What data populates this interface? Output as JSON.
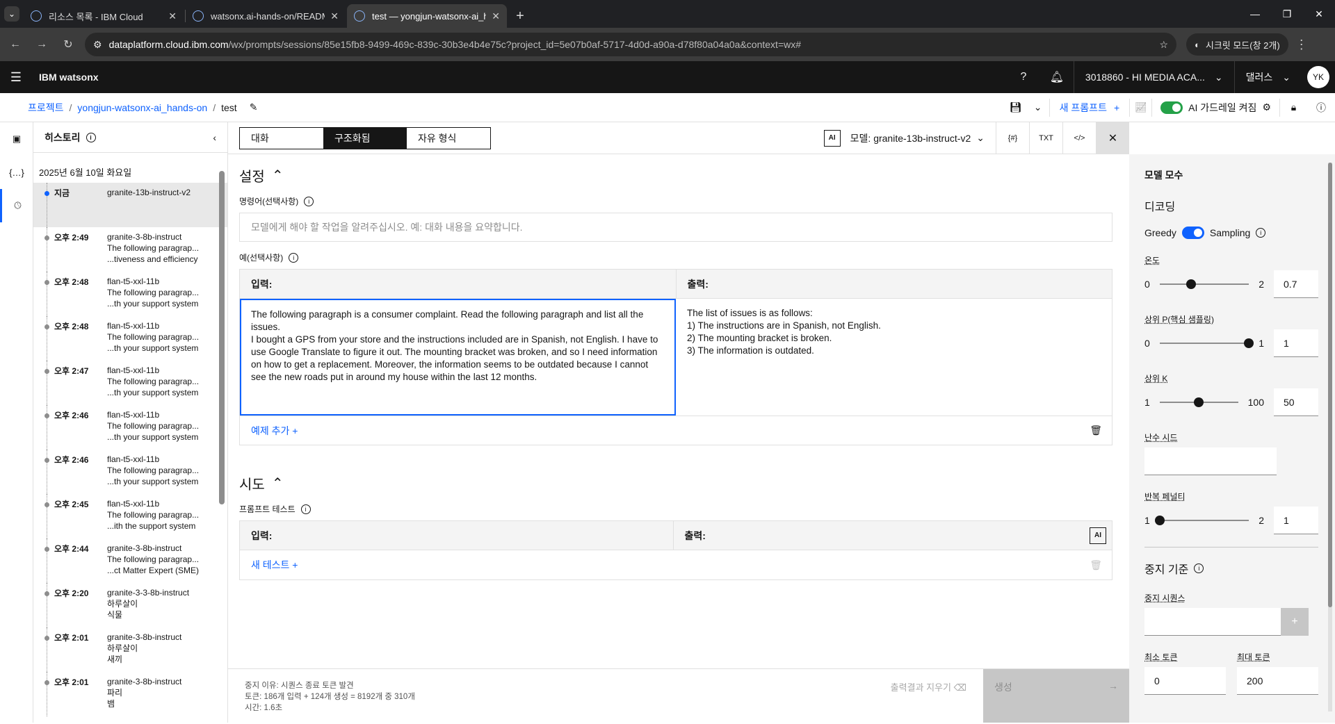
{
  "browser": {
    "tabs": [
      {
        "title": "리소스 목록 - IBM Cloud"
      },
      {
        "title": "watsonx.ai-hands-on/README"
      },
      {
        "title": "test — yongjun-watsonx-ai_ha"
      }
    ],
    "url_host": "dataplatform.cloud.ibm.com",
    "url_rest": "/wx/prompts/sessions/85e15fb8-9499-469c-839c-30b3e4b4e75c?project_id=5e07b0af-5717-4d0d-a90a-d78f80a04a0a&context=wx#",
    "incognito": "시크릿 모드(창 2개)"
  },
  "app": {
    "brand": "IBM watsonx",
    "account": "3018860 - HI MEDIA ACA...",
    "region": "댈러스",
    "avatar": "YK"
  },
  "breadcrumb": {
    "items": [
      "프로젝트",
      "yongjun-watsonx-ai_hands-on"
    ],
    "current": "test",
    "new_prompt": "새 프롬프트",
    "guardrail": "AI 가드레일 켜짐"
  },
  "history": {
    "title": "히스토리",
    "date": "2025년 6월 10일 화요일",
    "items": [
      {
        "time": "지금",
        "model": "granite-13b-instruct-v2",
        "line1": "",
        "line2": ""
      },
      {
        "time": "오후 2:49",
        "model": "granite-3-8b-instruct",
        "line1": "The following paragrap...",
        "line2": "...tiveness and efficiency"
      },
      {
        "time": "오후 2:48",
        "model": "flan-t5-xxl-11b",
        "line1": "The following paragrap...",
        "line2": "...th your support system"
      },
      {
        "time": "오후 2:48",
        "model": "flan-t5-xxl-11b",
        "line1": "The following paragrap...",
        "line2": "...th your support system"
      },
      {
        "time": "오후 2:47",
        "model": "flan-t5-xxl-11b",
        "line1": "The following paragrap...",
        "line2": "...th your support system"
      },
      {
        "time": "오후 2:46",
        "model": "flan-t5-xxl-11b",
        "line1": "The following paragrap...",
        "line2": "...th your support system"
      },
      {
        "time": "오후 2:46",
        "model": "flan-t5-xxl-11b",
        "line1": "The following paragrap...",
        "line2": "...th your support system"
      },
      {
        "time": "오후 2:45",
        "model": "flan-t5-xxl-11b",
        "line1": "The following paragrap...",
        "line2": "...ith the support system"
      },
      {
        "time": "오후 2:44",
        "model": "granite-3-8b-instruct",
        "line1": "The following paragrap...",
        "line2": "...ct Matter Expert (SME)"
      },
      {
        "time": "오후 2:20",
        "model": "granite-3-3-8b-instruct",
        "line1": "하루살이",
        "line2": "식물"
      },
      {
        "time": "오후 2:01",
        "model": "granite-3-8b-instruct",
        "line1": "하루살이",
        "line2": "새끼"
      },
      {
        "time": "오후 2:01",
        "model": "granite-3-8b-instruct",
        "line1": "파리",
        "line2": "뱀"
      }
    ]
  },
  "modes": {
    "chat": "대화",
    "structured": "구조화됨",
    "freeform": "자유 형식"
  },
  "model": {
    "ai": "AI",
    "label": "모델: granite-13b-instruct-v2",
    "txt": "TXT"
  },
  "setup": {
    "title": "설정",
    "instruction_label": "명령어(선택사항)",
    "instruction_placeholder": "모델에게 해야 할 작업을 알려주십시오. 예: 대화 내용을 요약합니다.",
    "examples_label": "예(선택사항)",
    "input_head": "입력:",
    "output_head": "출력:",
    "example_input": "The following paragraph is a consumer complaint. Read the following paragraph and list all the issues.\nI bought a GPS from your store and the instructions included are in Spanish, not English. I have to use Google Translate to figure it out. The mounting bracket was broken, and so I need information on how to get a replacement. Moreover, the information seems to be outdated because I cannot see the new roads put in around my house within the last 12 months.",
    "example_output": "The list of issues is as follows:\n1) The instructions are in Spanish, not English.\n2) The mounting bracket is broken.\n3) The information is outdated.",
    "add_example": "예제 추가  +"
  },
  "try": {
    "title": "시도",
    "test_label": "프롬프트 테스트",
    "input_head": "입력:",
    "output_head": "출력:",
    "new_test": "새 테스트  +"
  },
  "footer": {
    "stop_reason": "중지 이유: 시퀀스 종료 토큰 발견",
    "tokens": "토큰: 186개 입력 + 124개 생성 = 8192개 중 310개",
    "time": "시간: 1.6초",
    "clear": "출력결과 지우기",
    "generate": "생성"
  },
  "params": {
    "title": "모델 모수",
    "decoding": "디코딩",
    "greedy": "Greedy",
    "sampling": "Sampling",
    "temperature": {
      "label": "온도",
      "min": "0",
      "max": "2",
      "value": "0.7",
      "level": 0.35
    },
    "top_p": {
      "label": "상위 P(핵심 샘플링)",
      "min": "0",
      "max": "1",
      "value": "1",
      "level": 1.0
    },
    "top_k": {
      "label": "상위 K",
      "min": "1",
      "max": "100",
      "value": "50",
      "level": 0.5
    },
    "seed": {
      "label": "난수 시드"
    },
    "repetition": {
      "label": "반복 페널티",
      "min": "1",
      "max": "2",
      "value": "1",
      "level": 0.0
    },
    "stop_title": "중지 기준",
    "stop_seq": "중지 시퀀스",
    "min_tokens": {
      "label": "최소 토큰",
      "value": "0"
    },
    "max_tokens": {
      "label": "최대 토큰",
      "value": "200"
    }
  }
}
